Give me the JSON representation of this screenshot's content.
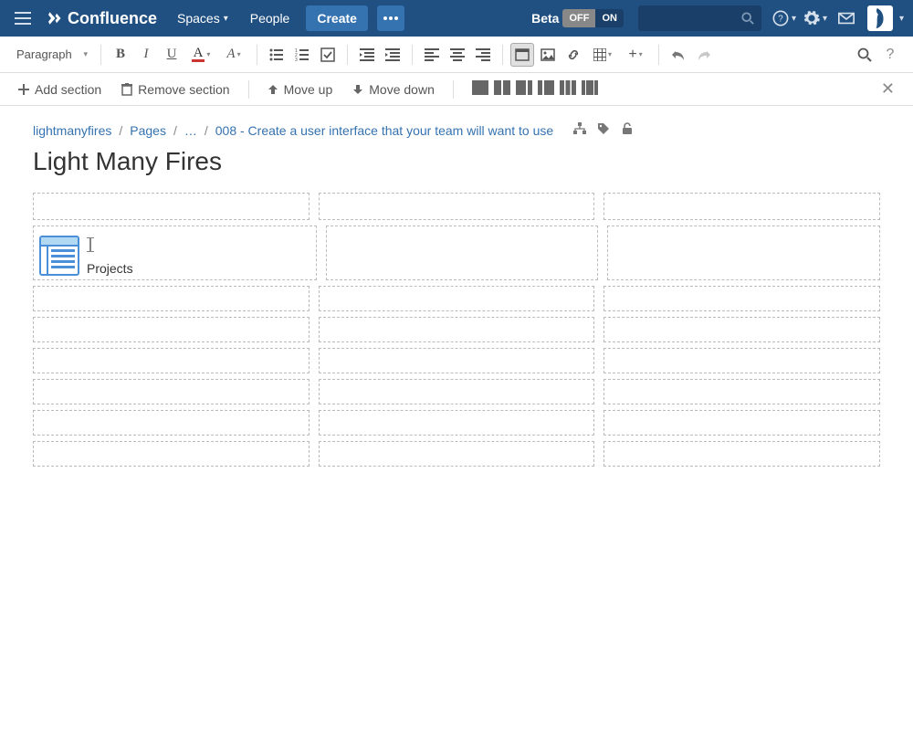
{
  "nav": {
    "product": "Confluence",
    "spaces": "Spaces",
    "people": "People",
    "create": "Create",
    "beta_label": "Beta",
    "toggle_off": "OFF",
    "toggle_on": "ON"
  },
  "format": {
    "style": "Paragraph",
    "bold": "B",
    "italic": "I",
    "underline": "U",
    "color_glyph": "A",
    "more_format": "A",
    "plus": "+"
  },
  "section": {
    "add": "Add section",
    "remove": "Remove section",
    "move_up": "Move up",
    "move_down": "Move down"
  },
  "crumbs": {
    "space": "lightmanyfires",
    "pages": "Pages",
    "ellipsis": "…",
    "current": "008 - Create a user interface that your team will want to use"
  },
  "page": {
    "title": "Light Many Fires"
  },
  "macro": {
    "label": "Projects"
  }
}
